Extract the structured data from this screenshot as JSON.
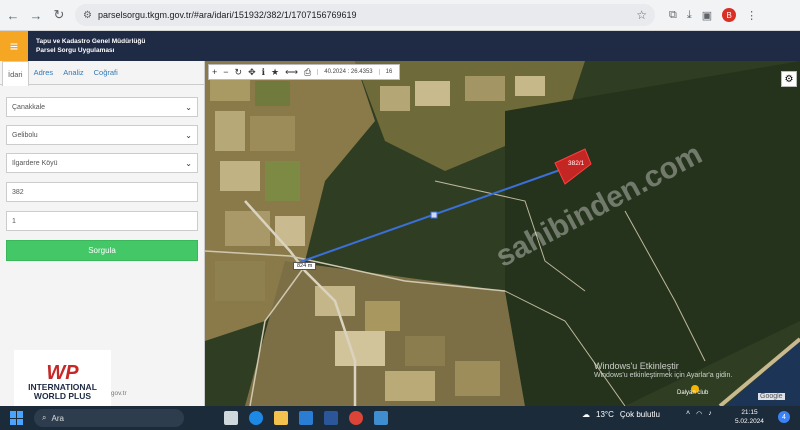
{
  "browser": {
    "url": "parselsorgu.tkgm.gov.tr/#ara/idari/151932/382/1/1707156769619",
    "profile_initial": "B"
  },
  "header": {
    "title_line1": "Tapu ve Kadastro Genel Müdürlüğü",
    "title_line2": "Parsel Sorgu Uygulaması"
  },
  "sidebar": {
    "tabs": [
      {
        "label": "İdari"
      },
      {
        "label": "Adres"
      },
      {
        "label": "Analiz"
      },
      {
        "label": "Coğrafi"
      }
    ],
    "province": "Çanakkale",
    "district": "Gelibolu",
    "neighborhood": "Ilgardere Köyü",
    "block": "382",
    "parcel": "1",
    "submit_label": "Sorgula",
    "footer_text": "gm.gov.tr"
  },
  "map": {
    "coordinates": "40.2024 : 26.4353",
    "zoom": "16",
    "parcel_label": "382/1",
    "distance_label": "824 m",
    "watermark_line1": "Windows'u Etkinleştir",
    "watermark_line2": "Windows'u etkinleştirmek için Ayarlar'a gidin.",
    "place_label": "Dalyan club",
    "google_label": "Google",
    "overlay_text": "sahibinden.com"
  },
  "logo": {
    "mark": "WP",
    "line1": "INTERNATIONAL",
    "line2": "WORLD PLUS"
  },
  "taskbar": {
    "search_placeholder": "Ara",
    "weather_temp": "13°C",
    "weather_text": "Çok bulutlu",
    "time": "21:15",
    "date": "5.02.2024",
    "notification_count": "4"
  }
}
